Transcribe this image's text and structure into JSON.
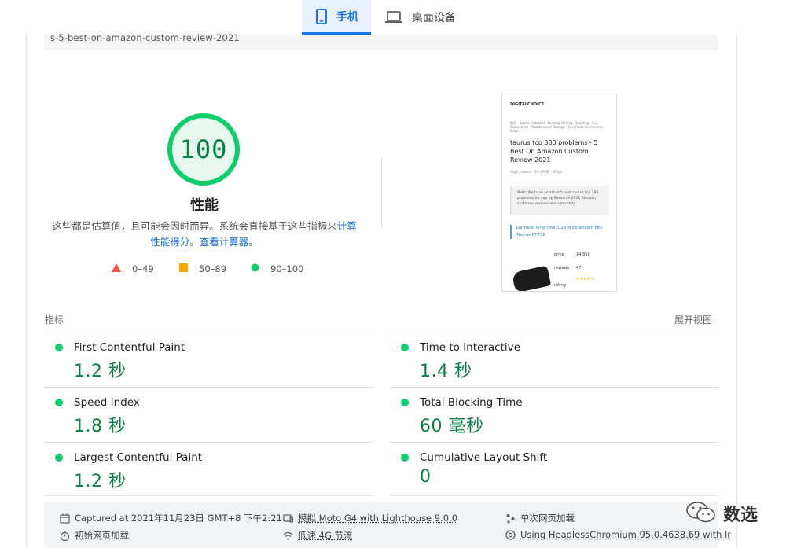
{
  "tabs": [
    {
      "label": "手机",
      "icon": "mobile-icon",
      "active": true
    },
    {
      "label": "桌面设备",
      "icon": "laptop-icon",
      "active": false
    }
  ],
  "url_fragment": "s-5-best-on-amazon-custom-review-2021",
  "score": {
    "value": "100",
    "label": "性能",
    "fraction": 1.0,
    "color": "#0cce6b"
  },
  "description": {
    "text": "这些都是估算值，且可能会因时而异。系统会直接基于这些指标来",
    "link1": "计算性能得分",
    "sep": "。",
    "link2": "查看计算器",
    "end": "。"
  },
  "legend": [
    {
      "range": "0–49",
      "shape": "triangle",
      "color": "#ff4e42"
    },
    {
      "range": "50–89",
      "shape": "square",
      "color": "#ffa400"
    },
    {
      "range": "90–100",
      "shape": "circle",
      "color": "#0cce6b"
    }
  ],
  "thumbnail": {
    "logo": "DIGITALCHOICE",
    "nav": "首页 · Sports Outdoors · Hunting Fishing · Shooting · Gun Accessories · Maintenance Storage · Gun Parts Accessories · Grips",
    "title": "taurus tcp 380 problems - 5 Best On Amazon Custom Review 2021",
    "meta": "digit_choice · 14小时前 · Grips",
    "note": "Note: We have selected 5 best taurus tcp 380 problems for you by Research 2021 Amazon customer reviews and sales data.",
    "product": "Garrison Grip One 1.25IN Extension Fits Taurus PT738",
    "price_label": "price",
    "price_value": "14.95$",
    "reviews_label": "reviews",
    "reviews_value": "47",
    "rating_label": "rating",
    "rating_stars": "★★★★½"
  },
  "metrics_section": {
    "title": "指标",
    "expand": "展开视图"
  },
  "metrics": [
    {
      "name": "First Contentful Paint",
      "value": "1.2 秒"
    },
    {
      "name": "Time to Interactive",
      "value": "1.4 秒"
    },
    {
      "name": "Speed Index",
      "value": "1.8 秒"
    },
    {
      "name": "Total Blocking Time",
      "value": "60 毫秒"
    },
    {
      "name": "Largest Contentful Paint",
      "value": "1.2 秒"
    },
    {
      "name": "Cumulative Layout Shift",
      "value": "0"
    }
  ],
  "footer": {
    "captured": "Captured at 2021年11月23日 GMT+8 下午2:21",
    "device": "模拟 Moto G4 with Lighthouse 9.0.0",
    "session": "单次网页加载",
    "initial_load": "初始网页加载",
    "network": "低速 4G 节流",
    "browser": "Using HeadlessChromium 95.0.4638.69 with lr"
  },
  "watermark": {
    "text": "数选",
    "icon": "wechat-icon"
  }
}
